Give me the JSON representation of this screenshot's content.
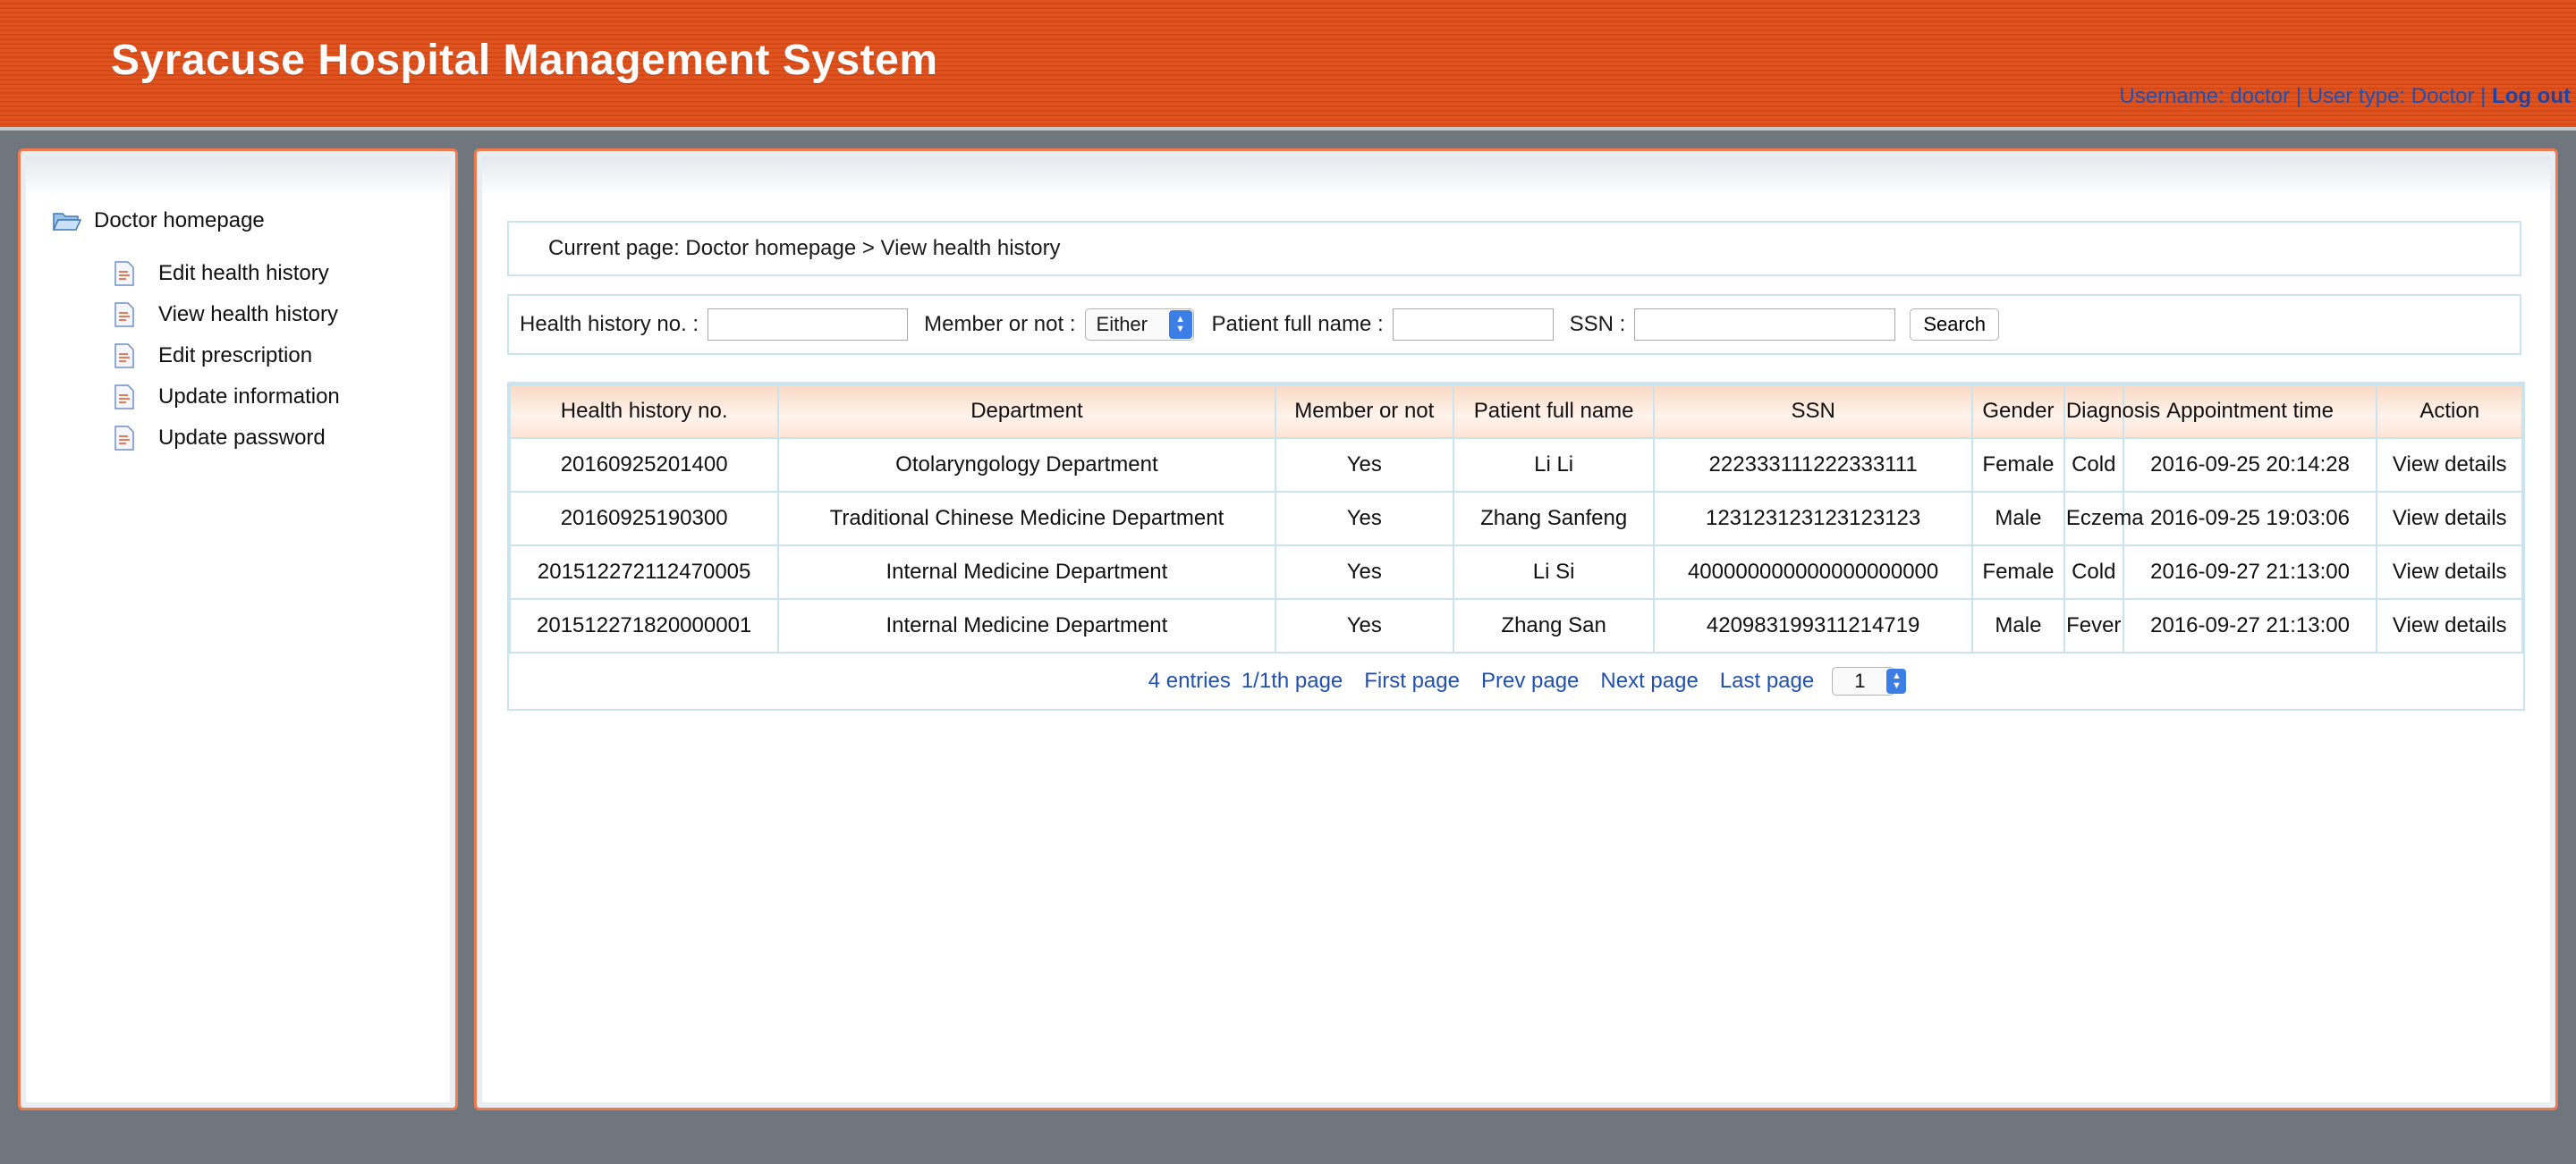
{
  "header": {
    "title": "Syracuse Hospital Management System",
    "username_text": "Username: doctor",
    "usertype_text": "User type: Doctor",
    "sep": "|",
    "logout": "Log out"
  },
  "sidebar": {
    "root": "Doctor homepage",
    "items": [
      {
        "label": "Edit health history"
      },
      {
        "label": "View health history"
      },
      {
        "label": "Edit prescription"
      },
      {
        "label": "Update information"
      },
      {
        "label": "Update password"
      }
    ]
  },
  "breadcrumb": "Current page: Doctor homepage > View health history",
  "search": {
    "health_no_label": "Health history no. :",
    "member_label": "Member or not :",
    "member_value": "Either",
    "name_label": "Patient full name :",
    "ssn_label": "SSN :",
    "button": "Search"
  },
  "table": {
    "headers": [
      "Health history no.",
      "Department",
      "Member or not",
      "Patient full name",
      "SSN",
      "Gender",
      "Diagnosis",
      "Appointment time",
      "Action"
    ],
    "rows": [
      [
        "20160925201400",
        "Otolaryngology Department",
        "Yes",
        "Li Li",
        "222333111222333111",
        "Female",
        "Cold",
        "2016-09-25 20:14:28",
        "View details"
      ],
      [
        "20160925190300",
        "Traditional Chinese Medicine Department",
        "Yes",
        "Zhang Sanfeng",
        "123123123123123123",
        "Male",
        "Eczema",
        "2016-09-25 19:03:06",
        "View details"
      ],
      [
        "201512272112470005",
        "Internal Medicine Department",
        "Yes",
        "Li Si",
        "400000000000000000000",
        "Female",
        "Cold",
        "2016-09-27 21:13:00",
        "View details"
      ],
      [
        "201512271820000001",
        "Internal Medicine Department",
        "Yes",
        "Zhang San",
        "420983199311214719",
        "Male",
        "Fever",
        "2016-09-27 21:13:00",
        "View details"
      ]
    ]
  },
  "pager": {
    "entries": "4 entries",
    "page_info": "1/1th page",
    "first": "First page",
    "prev": "Prev page",
    "next": "Next page",
    "last": "Last page",
    "page_value": "1"
  }
}
